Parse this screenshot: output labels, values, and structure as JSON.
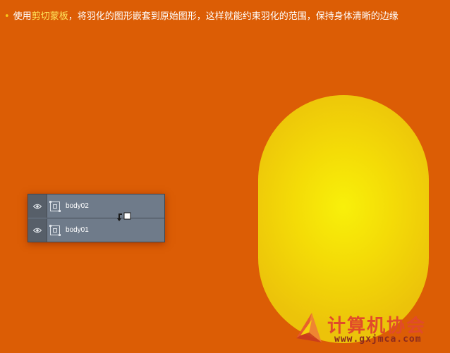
{
  "instruction": {
    "bullet": "•",
    "prefix": "使用",
    "highlight": "剪切蒙板",
    "suffix": "，将羽化的图形嵌套到原始图形，这样就能约束羽化的范围，保持身体清晰的边缘"
  },
  "layers": [
    {
      "name": "body02",
      "visible": true,
      "icon": "eye-icon"
    },
    {
      "name": "body01",
      "visible": true,
      "icon": "eye-icon"
    }
  ],
  "colors": {
    "background": "#dc5d05",
    "highlight_text": "#ffe65c",
    "capsule_center": "#f8f00a",
    "capsule_edge": "#ecc30a",
    "panel": "#6f7b8a"
  },
  "watermark": {
    "title": "计算机协会",
    "url": "www.gxjmca.com"
  }
}
